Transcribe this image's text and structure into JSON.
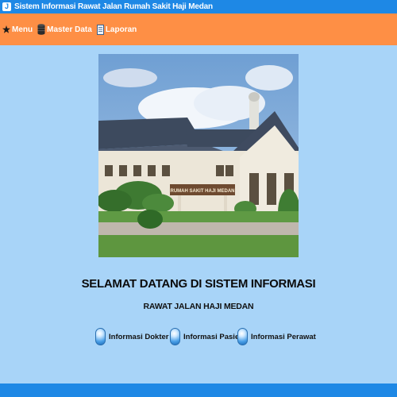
{
  "window": {
    "title": "Sistem Informasi Rawat Jalan Rumah Sakit Haji Medan"
  },
  "menubar": {
    "items": [
      {
        "label": "Menu",
        "icon": "star-icon"
      },
      {
        "label": "Master Data",
        "icon": "database-icon"
      },
      {
        "label": "Laporan",
        "icon": "document-icon"
      }
    ]
  },
  "hero": {
    "building_sign": "RUMAH SAKIT HAJI MEDAN"
  },
  "main": {
    "welcome_title": "SELAMAT DATANG DI SISTEM INFORMASI",
    "subtitle": "RAWAT JALAN HAJI MEDAN",
    "links": [
      {
        "label": "Informasi Dokter",
        "icon": "orb-icon"
      },
      {
        "label": "Informasi Pasien",
        "icon": "orb-icon"
      },
      {
        "label": "Informasi Perawat",
        "icon": "orb-icon"
      }
    ]
  },
  "colors": {
    "titlebar": "#1e88e5",
    "menubar": "#fe8f45",
    "background": "#a8d4f8"
  }
}
